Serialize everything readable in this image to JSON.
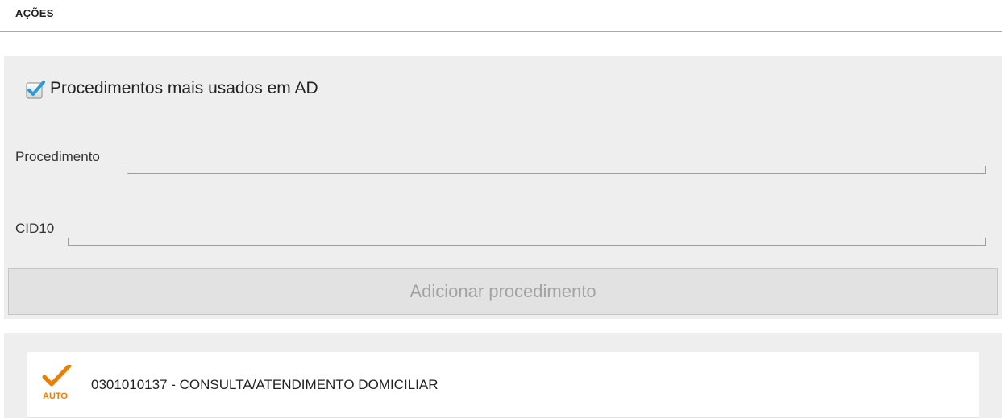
{
  "header": {
    "title": "AÇÕES"
  },
  "form": {
    "checkbox": {
      "label": "Procedimentos mais usados em AD",
      "checked": true
    },
    "procedimento": {
      "label": "Procedimento",
      "value": ""
    },
    "cid10": {
      "label": "CID10",
      "value": ""
    },
    "add_button_label": "Adicionar procedimento"
  },
  "list": {
    "items": [
      {
        "badge": "AUTO",
        "text": "0301010137 - CONSULTA/ATENDIMENTO DOMICILIAR",
        "icon": "checkmark-icon"
      }
    ]
  },
  "colors": {
    "accent_check": "#f07d00",
    "checkbox_blue": "#2a9ad9",
    "panel_bg": "#eeeeee",
    "button_text_disabled": "#a3a3a3"
  }
}
